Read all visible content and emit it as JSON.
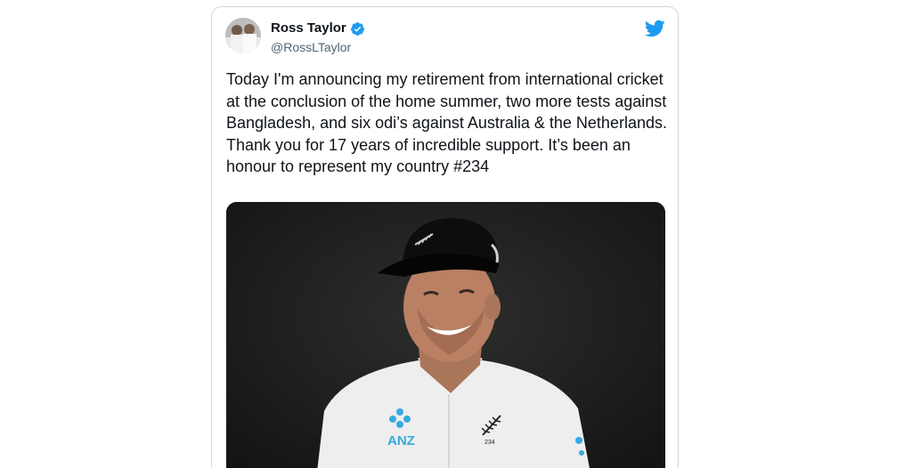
{
  "tweet": {
    "author": {
      "name": "Ross Taylor",
      "handle": "@RossLTaylor",
      "verified": true
    },
    "text": "Today I'm announcing my retirement from international cricket at the conclusion of the home summer, two more tests against Bangladesh, and six odi’s against Australia & the Netherlands. Thank you for 17 years of incredible support. It’s been an honour to represent my country #234",
    "media": {
      "shirt_logo": "ANZ",
      "shirt_number": "234"
    }
  },
  "colors": {
    "twitter_blue": "#1d9bf0",
    "text_primary": "#0f1419",
    "text_secondary": "#536471"
  },
  "icons": [
    "twitter-bird-icon",
    "verified-badge-icon"
  ]
}
